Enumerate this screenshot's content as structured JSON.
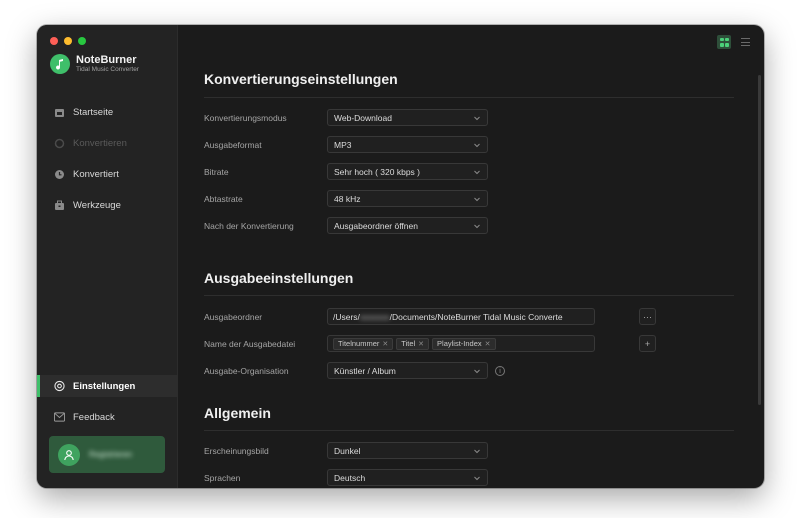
{
  "app": {
    "name": "NoteBurner",
    "subtitle": "Tidal Music Converter"
  },
  "sidebar": {
    "items": [
      {
        "label": "Startseite",
        "icon": "home-icon",
        "state": "normal"
      },
      {
        "label": "Konvertieren",
        "icon": "convert-icon",
        "state": "disabled"
      },
      {
        "label": "Konvertiert",
        "icon": "clock-icon",
        "state": "normal"
      },
      {
        "label": "Werkzeuge",
        "icon": "toolbox-icon",
        "state": "normal"
      }
    ],
    "bottom": [
      {
        "label": "Einstellungen",
        "icon": "settings-icon",
        "state": "active"
      },
      {
        "label": "Feedback",
        "icon": "mail-icon",
        "state": "normal"
      }
    ],
    "register_label": "Registrieren"
  },
  "sections": {
    "conversion": {
      "title": "Konvertierungseinstellungen",
      "rows": [
        {
          "label": "Konvertierungsmodus",
          "value": "Web-Download"
        },
        {
          "label": "Ausgabeformat",
          "value": "MP3"
        },
        {
          "label": "Bitrate",
          "value": "Sehr hoch ( 320 kbps )"
        },
        {
          "label": "Abtastrate",
          "value": "48 kHz"
        },
        {
          "label": "Nach der Konvertierung",
          "value": "Ausgabeordner öffnen"
        }
      ]
    },
    "output": {
      "title": "Ausgabeeinstellungen",
      "folder_label": "Ausgabeordner",
      "folder_prefix": "/Users/",
      "folder_user": "xxxxxxx",
      "folder_suffix": "/Documents/NoteBurner Tidal Music Converte",
      "folder_button": "···",
      "filename_label": "Name der Ausgabedatei",
      "filename_tags": [
        "Titelnummer",
        "Titel",
        "Playlist-Index"
      ],
      "filename_add": "+",
      "organization_label": "Ausgabe-Organisation",
      "organization_value": "Künstler  /  Album"
    },
    "general": {
      "title": "Allgemein",
      "rows": [
        {
          "label": "Erscheinungsbild",
          "value": "Dunkel"
        },
        {
          "label": "Sprachen",
          "value": "Deutsch"
        }
      ]
    }
  },
  "colors": {
    "accent": "#3fbf6a",
    "background": "#1b1b1b",
    "sidebar": "#232323"
  }
}
